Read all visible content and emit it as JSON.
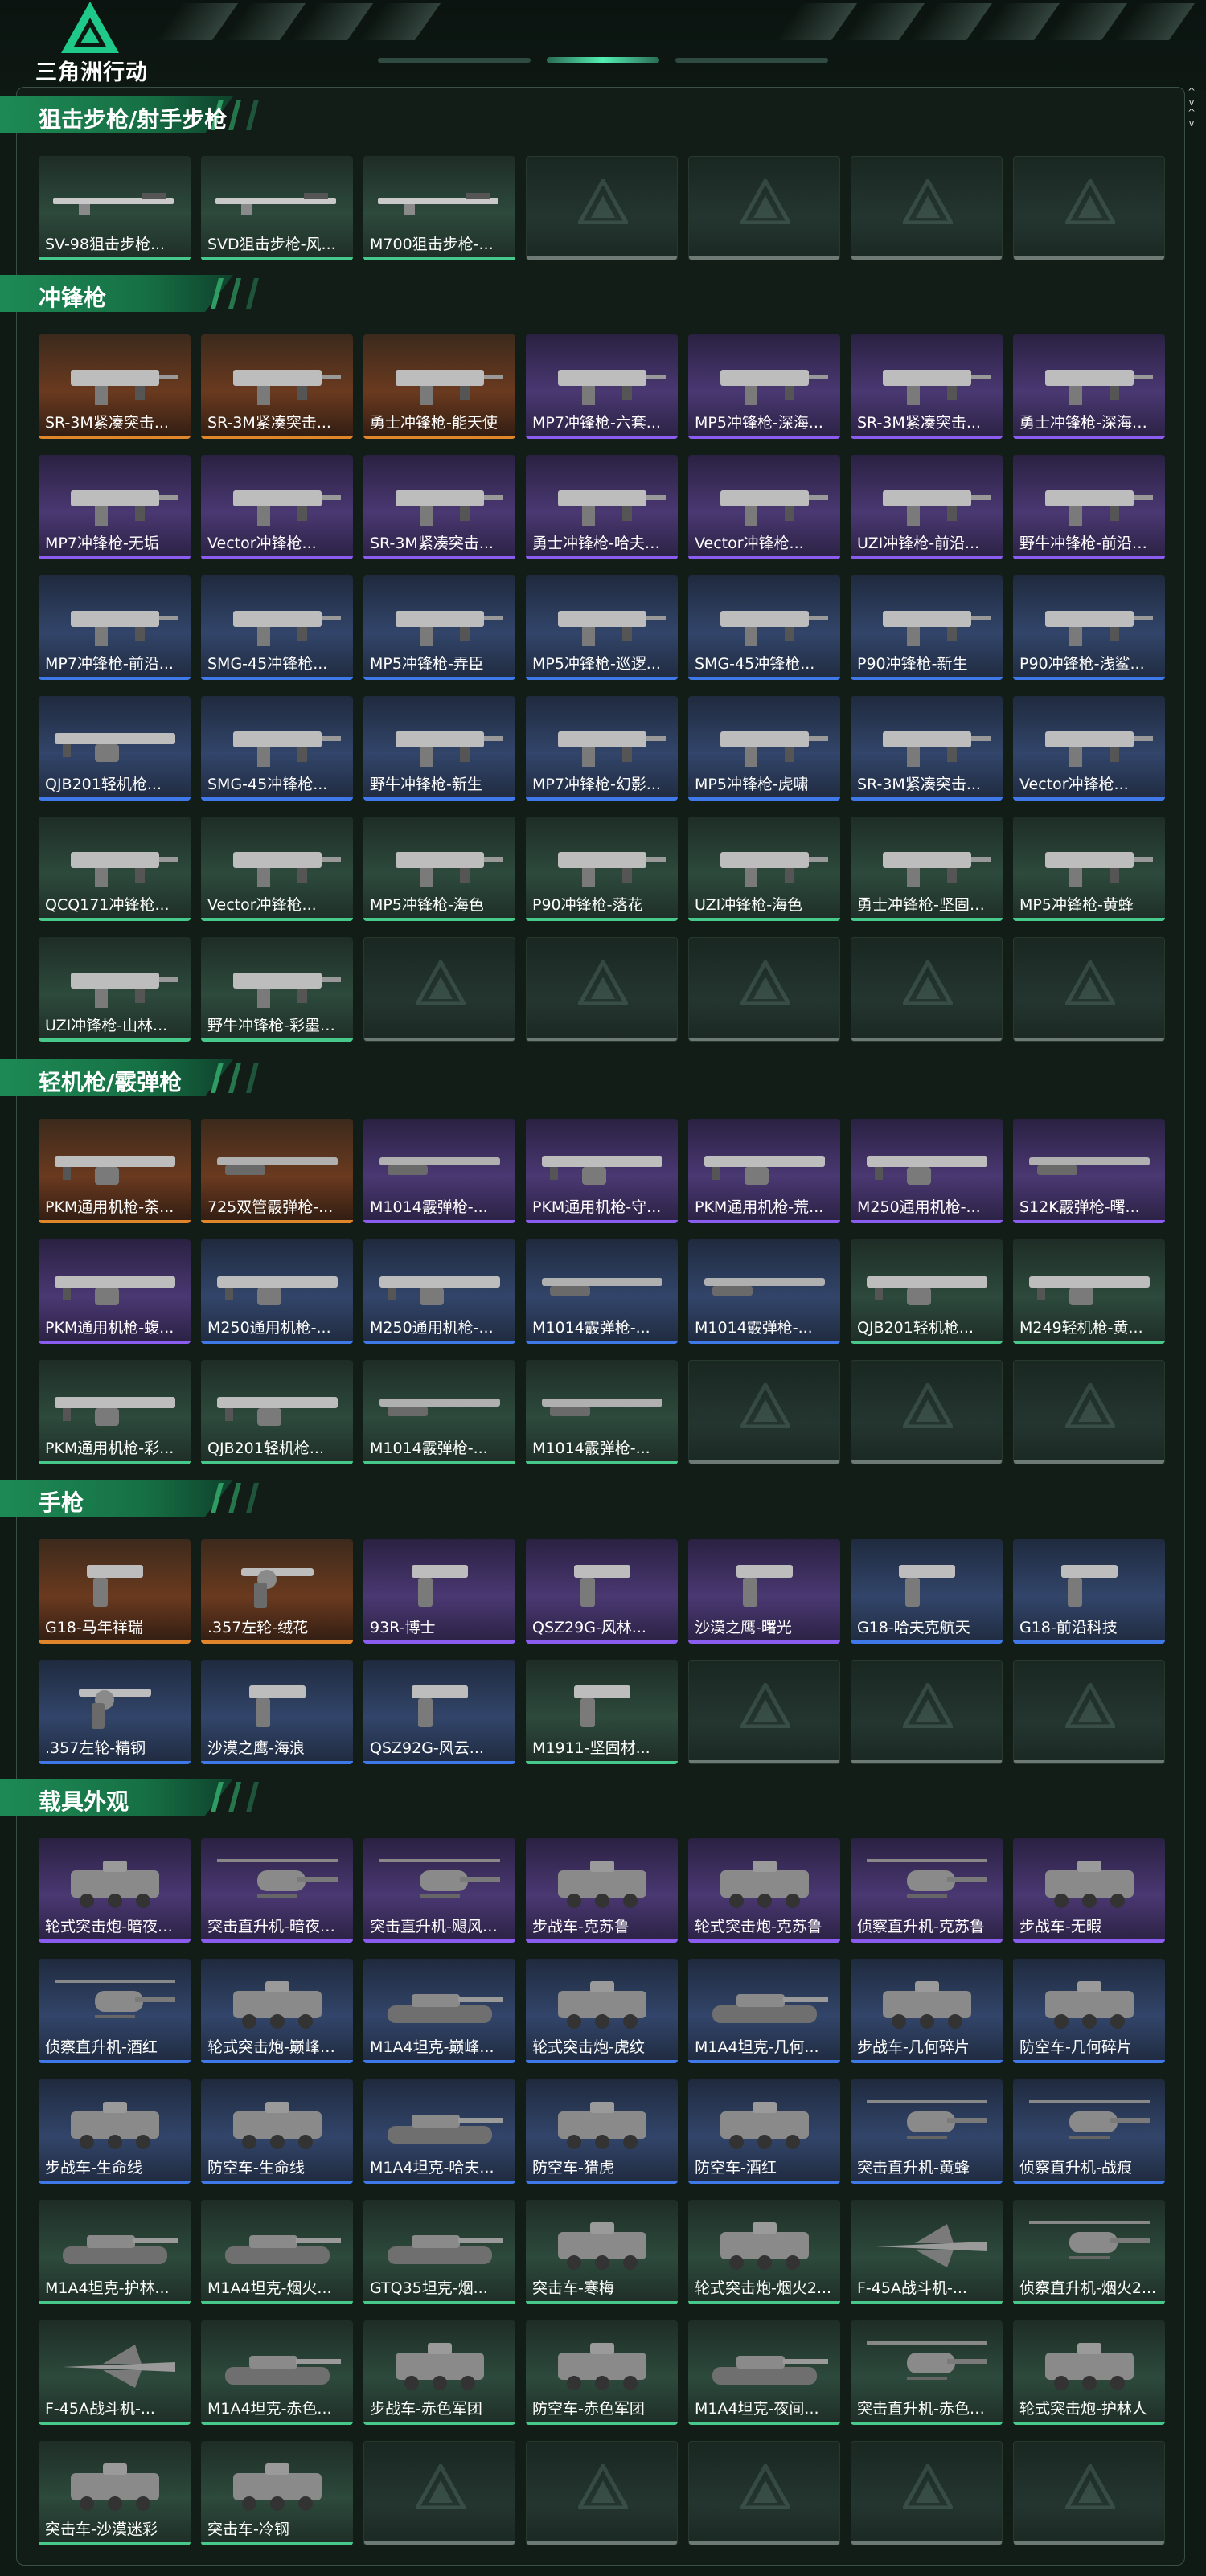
{
  "app": {
    "logo_text": "三角洲行动"
  },
  "scroll": {
    "arrows": "^\nv\n^\nv"
  },
  "sections": [
    {
      "id": "sniper",
      "title": "狙击步枪/射手步枪",
      "items": [
        {
          "label": "SV-98狙击步枪...",
          "rarity": "green",
          "icon": "rifle-icon"
        },
        {
          "label": "SVD狙击步枪-风...",
          "rarity": "green",
          "icon": "rifle-icon"
        },
        {
          "label": "M700狙击步枪-...",
          "rarity": "green",
          "icon": "rifle-icon"
        },
        {
          "label": "",
          "rarity": "empty"
        },
        {
          "label": "",
          "rarity": "empty"
        },
        {
          "label": "",
          "rarity": "empty"
        },
        {
          "label": "",
          "rarity": "empty"
        }
      ]
    },
    {
      "id": "smg",
      "title": "冲锋枪",
      "items": [
        {
          "label": "SR-3M紧凑突击...",
          "rarity": "gold",
          "icon": "smg-icon"
        },
        {
          "label": "SR-3M紧凑突击...",
          "rarity": "gold",
          "icon": "smg-icon"
        },
        {
          "label": "勇士冲锋枪-能天使",
          "rarity": "gold",
          "icon": "smg-icon"
        },
        {
          "label": "MP7冲锋枪-六套...",
          "rarity": "purple",
          "icon": "smg-icon"
        },
        {
          "label": "MP5冲锋枪-深海...",
          "rarity": "purple",
          "icon": "smg-icon"
        },
        {
          "label": "SR-3M紧凑突击...",
          "rarity": "purple",
          "icon": "smg-icon"
        },
        {
          "label": "勇士冲锋枪-深海恐...",
          "rarity": "purple",
          "icon": "smg-icon"
        },
        {
          "label": "MP7冲锋枪-无垢",
          "rarity": "purple",
          "icon": "smg-icon"
        },
        {
          "label": "Vector冲锋枪...",
          "rarity": "purple",
          "icon": "smg-icon"
        },
        {
          "label": "SR-3M紧凑突击...",
          "rarity": "purple",
          "icon": "smg-icon"
        },
        {
          "label": "勇士冲锋枪-哈夫克...",
          "rarity": "purple",
          "icon": "smg-icon"
        },
        {
          "label": "Vector冲锋枪...",
          "rarity": "purple",
          "icon": "smg-icon"
        },
        {
          "label": "UZI冲锋枪-前沿...",
          "rarity": "purple",
          "icon": "smg-icon"
        },
        {
          "label": "野牛冲锋枪-前沿科...",
          "rarity": "purple",
          "icon": "smg-icon"
        },
        {
          "label": "MP7冲锋枪-前沿...",
          "rarity": "blue",
          "icon": "smg-icon"
        },
        {
          "label": "SMG-45冲锋枪...",
          "rarity": "blue",
          "icon": "smg-icon"
        },
        {
          "label": "MP5冲锋枪-弄臣",
          "rarity": "blue",
          "icon": "smg-icon"
        },
        {
          "label": "MP5冲锋枪-巡逻...",
          "rarity": "blue",
          "icon": "smg-icon"
        },
        {
          "label": "SMG-45冲锋枪...",
          "rarity": "blue",
          "icon": "smg-icon"
        },
        {
          "label": "P90冲锋枪-新生",
          "rarity": "blue",
          "icon": "smg-icon"
        },
        {
          "label": "P90冲锋枪-浅鲨...",
          "rarity": "blue",
          "icon": "smg-icon"
        },
        {
          "label": "QJB201轻机枪...",
          "rarity": "blue",
          "icon": "lmg-icon"
        },
        {
          "label": "SMG-45冲锋枪...",
          "rarity": "blue",
          "icon": "smg-icon"
        },
        {
          "label": "野牛冲锋枪-新生",
          "rarity": "blue",
          "icon": "smg-icon"
        },
        {
          "label": "MP7冲锋枪-幻影...",
          "rarity": "blue",
          "icon": "smg-icon"
        },
        {
          "label": "MP5冲锋枪-虎啸",
          "rarity": "blue",
          "icon": "smg-icon"
        },
        {
          "label": "SR-3M紧凑突击...",
          "rarity": "blue",
          "icon": "smg-icon"
        },
        {
          "label": "Vector冲锋枪...",
          "rarity": "blue",
          "icon": "smg-icon"
        },
        {
          "label": "QCQ171冲锋枪...",
          "rarity": "green",
          "icon": "smg-icon"
        },
        {
          "label": "Vector冲锋枪...",
          "rarity": "green",
          "icon": "smg-icon"
        },
        {
          "label": "MP5冲锋枪-海色",
          "rarity": "green",
          "icon": "smg-icon"
        },
        {
          "label": "P90冲锋枪-落花",
          "rarity": "green",
          "icon": "smg-icon"
        },
        {
          "label": "UZI冲锋枪-海色",
          "rarity": "green",
          "icon": "smg-icon"
        },
        {
          "label": "勇士冲锋枪-坚固材...",
          "rarity": "green",
          "icon": "smg-icon"
        },
        {
          "label": "MP5冲锋枪-黄蜂",
          "rarity": "green",
          "icon": "smg-icon"
        },
        {
          "label": "UZI冲锋枪-山林...",
          "rarity": "green",
          "icon": "smg-icon"
        },
        {
          "label": "野牛冲锋枪-彩墨喷...",
          "rarity": "green",
          "icon": "smg-icon"
        },
        {
          "label": "",
          "rarity": "empty"
        },
        {
          "label": "",
          "rarity": "empty"
        },
        {
          "label": "",
          "rarity": "empty"
        },
        {
          "label": "",
          "rarity": "empty"
        },
        {
          "label": "",
          "rarity": "empty"
        }
      ]
    },
    {
      "id": "lmg",
      "title": "轻机枪/霰弹枪",
      "items": [
        {
          "label": "PKM通用机枪-荼...",
          "rarity": "gold",
          "icon": "lmg-icon"
        },
        {
          "label": "725双管霰弹枪-...",
          "rarity": "gold",
          "icon": "shotgun-icon"
        },
        {
          "label": "M1014霰弹枪-...",
          "rarity": "purple",
          "icon": "shotgun-icon"
        },
        {
          "label": "PKM通用机枪-守...",
          "rarity": "purple",
          "icon": "lmg-icon"
        },
        {
          "label": "PKM通用机枪-荒...",
          "rarity": "purple",
          "icon": "lmg-icon"
        },
        {
          "label": "M250通用机枪-...",
          "rarity": "purple",
          "icon": "lmg-icon"
        },
        {
          "label": "S12K霰弹枪-曙...",
          "rarity": "purple",
          "icon": "shotgun-icon"
        },
        {
          "label": "PKM通用机枪-蝮...",
          "rarity": "purple",
          "icon": "lmg-icon"
        },
        {
          "label": "M250通用机枪-...",
          "rarity": "blue",
          "icon": "lmg-icon"
        },
        {
          "label": "M250通用机枪-...",
          "rarity": "blue",
          "icon": "lmg-icon"
        },
        {
          "label": "M1014霰弹枪-...",
          "rarity": "blue",
          "icon": "shotgun-icon"
        },
        {
          "label": "M1014霰弹枪-...",
          "rarity": "blue",
          "icon": "shotgun-icon"
        },
        {
          "label": "QJB201轻机枪...",
          "rarity": "green",
          "icon": "lmg-icon"
        },
        {
          "label": "M249轻机枪-黄...",
          "rarity": "green",
          "icon": "lmg-icon"
        },
        {
          "label": "PKM通用机枪-彩...",
          "rarity": "green",
          "icon": "lmg-icon"
        },
        {
          "label": "QJB201轻机枪...",
          "rarity": "green",
          "icon": "lmg-icon"
        },
        {
          "label": "M1014霰弹枪-...",
          "rarity": "green",
          "icon": "shotgun-icon"
        },
        {
          "label": "M1014霰弹枪-...",
          "rarity": "green",
          "icon": "shotgun-icon"
        },
        {
          "label": "",
          "rarity": "empty"
        },
        {
          "label": "",
          "rarity": "empty"
        },
        {
          "label": "",
          "rarity": "empty"
        }
      ]
    },
    {
      "id": "pistol",
      "title": "手枪",
      "items": [
        {
          "label": "G18-马年祥瑞",
          "rarity": "gold",
          "icon": "pistol-icon"
        },
        {
          "label": ".357左轮-绒花",
          "rarity": "gold",
          "icon": "revolver-icon"
        },
        {
          "label": "93R-博士",
          "rarity": "purple",
          "icon": "pistol-icon"
        },
        {
          "label": "QSZ29G-风林...",
          "rarity": "purple",
          "icon": "pistol-icon"
        },
        {
          "label": "沙漠之鹰-曙光",
          "rarity": "purple",
          "icon": "pistol-icon"
        },
        {
          "label": "G18-哈夫克航天",
          "rarity": "blue",
          "icon": "pistol-icon"
        },
        {
          "label": "G18-前沿科技",
          "rarity": "blue",
          "icon": "pistol-icon"
        },
        {
          "label": ".357左轮-精钢",
          "rarity": "blue",
          "icon": "revolver-icon"
        },
        {
          "label": "沙漠之鹰-海浪",
          "rarity": "blue",
          "icon": "pistol-icon"
        },
        {
          "label": "QSZ92G-风云...",
          "rarity": "blue",
          "icon": "pistol-icon"
        },
        {
          "label": "M1911-坚固材...",
          "rarity": "green",
          "icon": "pistol-icon"
        },
        {
          "label": "",
          "rarity": "empty"
        },
        {
          "label": "",
          "rarity": "empty"
        },
        {
          "label": "",
          "rarity": "empty"
        }
      ]
    },
    {
      "id": "vehicle",
      "title": "载具外观",
      "items": [
        {
          "label": "轮式突击炮-暗夜行...",
          "rarity": "purple",
          "icon": "armored-car-icon"
        },
        {
          "label": "突击直升机-暗夜行...",
          "rarity": "purple",
          "icon": "helicopter-icon"
        },
        {
          "label": "突击直升机-飓风行...",
          "rarity": "purple",
          "icon": "helicopter-icon"
        },
        {
          "label": "步战车-克苏鲁",
          "rarity": "purple",
          "icon": "armored-car-icon"
        },
        {
          "label": "轮式突击炮-克苏鲁",
          "rarity": "purple",
          "icon": "armored-car-icon"
        },
        {
          "label": "侦察直升机-克苏鲁",
          "rarity": "purple",
          "icon": "helicopter-icon"
        },
        {
          "label": "步战车-无暇",
          "rarity": "purple",
          "icon": "armored-car-icon"
        },
        {
          "label": "侦察直升机-酒红",
          "rarity": "blue",
          "icon": "helicopter-icon"
        },
        {
          "label": "轮式突击炮-巅峰竞...",
          "rarity": "blue",
          "icon": "armored-car-icon"
        },
        {
          "label": "M1A4坦克-巅峰...",
          "rarity": "blue",
          "icon": "tank-icon"
        },
        {
          "label": "轮式突击炮-虎纹",
          "rarity": "blue",
          "icon": "armored-car-icon"
        },
        {
          "label": "M1A4坦克-几何...",
          "rarity": "blue",
          "icon": "tank-icon"
        },
        {
          "label": "步战车-几何碎片",
          "rarity": "blue",
          "icon": "armored-car-icon"
        },
        {
          "label": "防空车-几何碎片",
          "rarity": "blue",
          "icon": "armored-car-icon"
        },
        {
          "label": "步战车-生命线",
          "rarity": "blue",
          "icon": "armored-car-icon"
        },
        {
          "label": "防空车-生命线",
          "rarity": "blue",
          "icon": "armored-car-icon"
        },
        {
          "label": "M1A4坦克-哈夫...",
          "rarity": "blue",
          "icon": "tank-icon"
        },
        {
          "label": "防空车-猎虎",
          "rarity": "blue",
          "icon": "armored-car-icon"
        },
        {
          "label": "防空车-酒红",
          "rarity": "blue",
          "icon": "armored-car-icon"
        },
        {
          "label": "突击直升机-黄蜂",
          "rarity": "blue",
          "icon": "helicopter-icon"
        },
        {
          "label": "侦察直升机-战痕",
          "rarity": "blue",
          "icon": "helicopter-icon"
        },
        {
          "label": "M1A4坦克-护林...",
          "rarity": "green",
          "icon": "tank-icon"
        },
        {
          "label": "M1A4坦克-烟火...",
          "rarity": "green",
          "icon": "tank-icon"
        },
        {
          "label": "GTQ35坦克-烟...",
          "rarity": "green",
          "icon": "tank-icon"
        },
        {
          "label": "突击车-寒梅",
          "rarity": "green",
          "icon": "armored-car-icon"
        },
        {
          "label": "轮式突击炮-烟火2...",
          "rarity": "green",
          "icon": "armored-car-icon"
        },
        {
          "label": "F-45A战斗机-...",
          "rarity": "green",
          "icon": "jet-icon"
        },
        {
          "label": "侦察直升机-烟火2...",
          "rarity": "green",
          "icon": "helicopter-icon"
        },
        {
          "label": "F-45A战斗机-...",
          "rarity": "green",
          "icon": "jet-icon"
        },
        {
          "label": "M1A4坦克-赤色...",
          "rarity": "green",
          "icon": "tank-icon"
        },
        {
          "label": "步战车-赤色军团",
          "rarity": "green",
          "icon": "armored-car-icon"
        },
        {
          "label": "防空车-赤色军团",
          "rarity": "green",
          "icon": "armored-car-icon"
        },
        {
          "label": "M1A4坦克-夜间...",
          "rarity": "green",
          "icon": "tank-icon"
        },
        {
          "label": "突击直升机-赤色军...",
          "rarity": "green",
          "icon": "helicopter-icon"
        },
        {
          "label": "轮式突击炮-护林人",
          "rarity": "green",
          "icon": "armored-car-icon"
        },
        {
          "label": "突击车-沙漠迷彩",
          "rarity": "green",
          "icon": "armored-car-icon"
        },
        {
          "label": "突击车-冷钢",
          "rarity": "green",
          "icon": "armored-car-icon"
        },
        {
          "label": "",
          "rarity": "empty"
        },
        {
          "label": "",
          "rarity": "empty"
        },
        {
          "label": "",
          "rarity": "empty"
        },
        {
          "label": "",
          "rarity": "empty"
        },
        {
          "label": "",
          "rarity": "empty"
        }
      ]
    }
  ],
  "colors": {
    "gold": "#e0852a",
    "purple": "#8a5cf0",
    "blue": "#3f78e8",
    "green": "#46c98a",
    "empty": "#6d7a76",
    "accent": "#1d8a55"
  }
}
